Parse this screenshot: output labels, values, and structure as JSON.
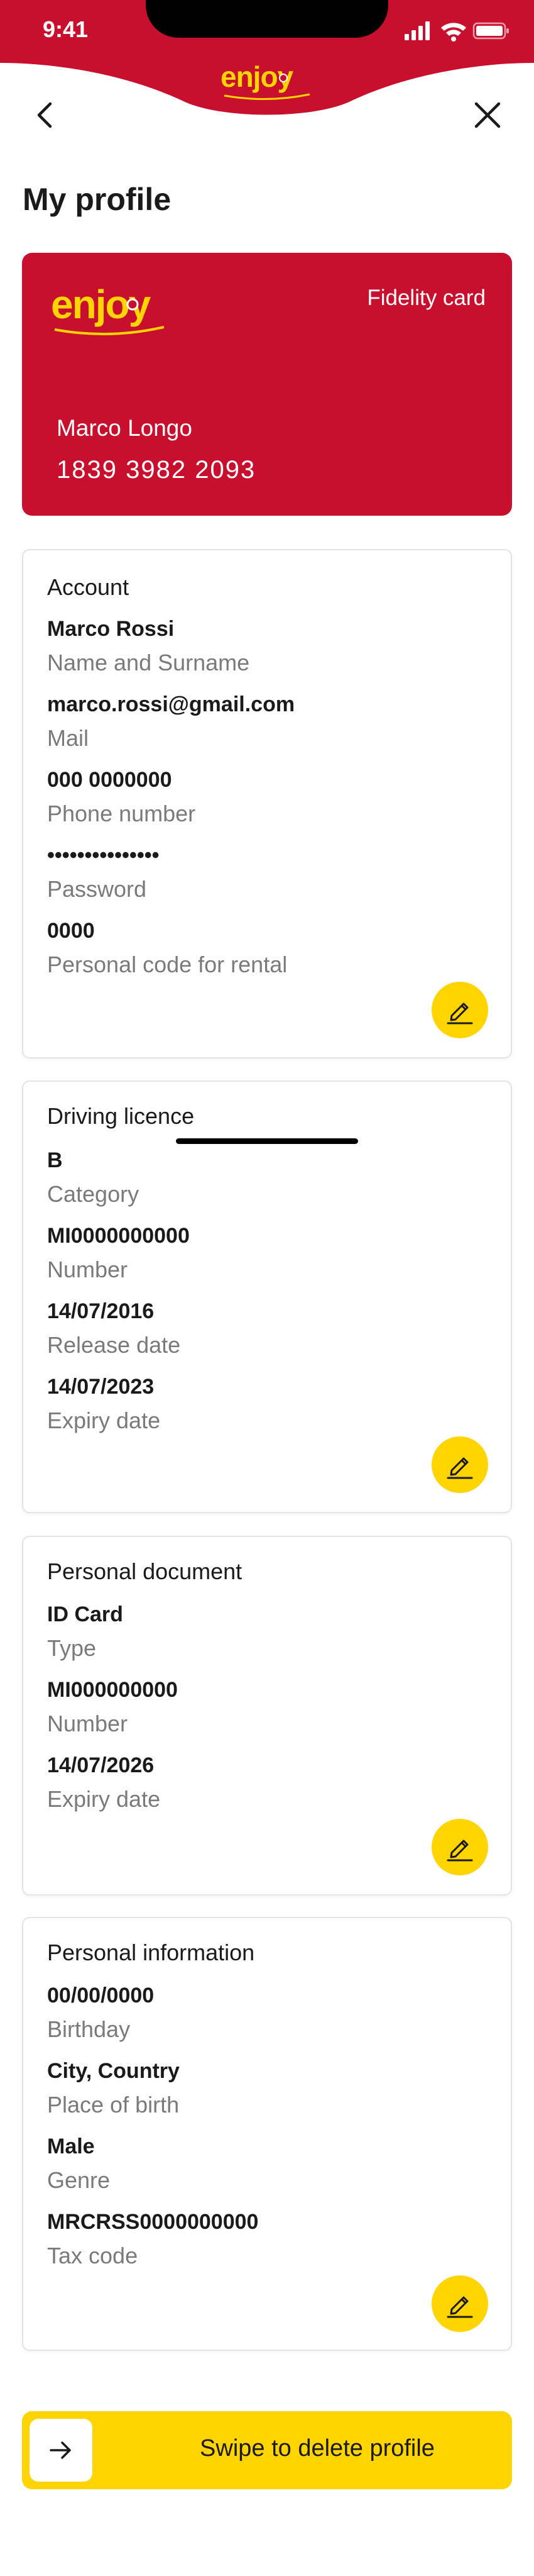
{
  "status_bar": {
    "time": "9:41"
  },
  "brand": {
    "logo_text": "enjoy",
    "color": "#c8102e",
    "accent": "#ffd400"
  },
  "nav": {
    "back_icon": "chevron-left-icon",
    "close_icon": "close-icon"
  },
  "page": {
    "title": "My profile"
  },
  "fidelity_card": {
    "type_label": "Fidelity card",
    "holder_name": "Marco Longo",
    "card_number": "1839 3982 2093"
  },
  "account": {
    "title": "Account",
    "fields": [
      {
        "value": "Marco Rossi",
        "label": "Name and Surname"
      },
      {
        "value": "marco.rossi@gmail.com",
        "label": "Mail"
      },
      {
        "value": "000 0000000",
        "label": "Phone number"
      },
      {
        "value": "•••••••••••••••",
        "label": "Password"
      },
      {
        "value": "0000",
        "label": "Personal code for rental"
      }
    ]
  },
  "driving_licence": {
    "title": "Driving licence",
    "fields": [
      {
        "value": "B",
        "label": "Category"
      },
      {
        "value": "MI0000000000",
        "label": "Number"
      },
      {
        "value": "14/07/2016",
        "label": "Release date"
      },
      {
        "value": "14/07/2023",
        "label": "Expiry date"
      }
    ]
  },
  "personal_document": {
    "title": "Personal document",
    "fields": [
      {
        "value": "ID Card",
        "label": "Type"
      },
      {
        "value": "MI000000000",
        "label": "Number"
      },
      {
        "value": "14/07/2026",
        "label": "Expiry date"
      }
    ]
  },
  "personal_information": {
    "title": "Personal information",
    "fields": [
      {
        "value": "00/00/0000",
        "label": "Birthday"
      },
      {
        "value": "City, Country",
        "label": "Place of birth"
      },
      {
        "value": "Male",
        "label": "Genre"
      },
      {
        "value": "MRCRSS0000000000",
        "label": "Tax code"
      }
    ]
  },
  "actions": {
    "swipe_delete_label": "Swipe to delete profile"
  }
}
